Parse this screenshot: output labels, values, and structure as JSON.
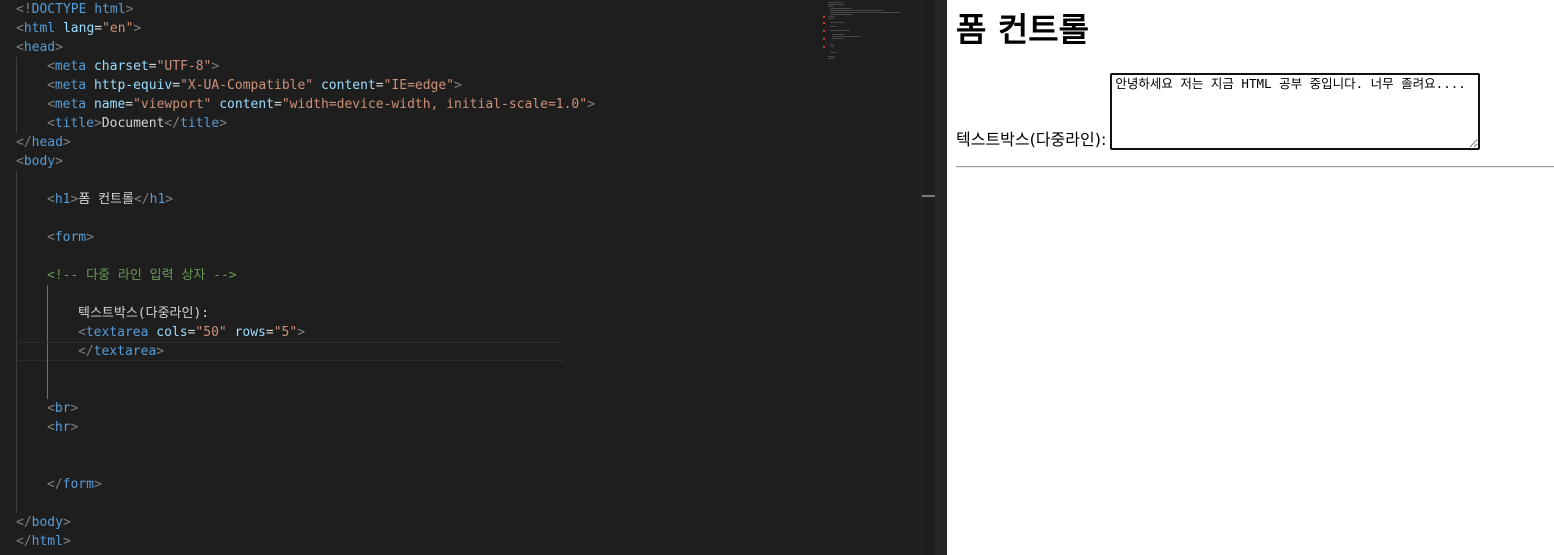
{
  "editor": {
    "lines": [
      {
        "indent": 0,
        "tokens": [
          [
            "punct",
            "<!"
          ],
          [
            "doctype",
            "DOCTYPE"
          ],
          [
            "text",
            " "
          ],
          [
            "tag",
            "html"
          ],
          [
            "punct",
            ">"
          ]
        ]
      },
      {
        "indent": 0,
        "tokens": [
          [
            "punct",
            "<"
          ],
          [
            "tag",
            "html"
          ],
          [
            "text",
            " "
          ],
          [
            "attr",
            "lang"
          ],
          [
            "text",
            "="
          ],
          [
            "str",
            "\"en\""
          ],
          [
            "punct",
            ">"
          ]
        ]
      },
      {
        "indent": 0,
        "tokens": [
          [
            "punct",
            "<"
          ],
          [
            "tag",
            "head"
          ],
          [
            "punct",
            ">"
          ]
        ]
      },
      {
        "indent": 1,
        "tokens": [
          [
            "punct",
            "<"
          ],
          [
            "tag",
            "meta"
          ],
          [
            "text",
            " "
          ],
          [
            "attr",
            "charset"
          ],
          [
            "text",
            "="
          ],
          [
            "str",
            "\"UTF-8\""
          ],
          [
            "punct",
            ">"
          ]
        ]
      },
      {
        "indent": 1,
        "tokens": [
          [
            "punct",
            "<"
          ],
          [
            "tag",
            "meta"
          ],
          [
            "text",
            " "
          ],
          [
            "attr",
            "http-equiv"
          ],
          [
            "text",
            "="
          ],
          [
            "str",
            "\"X-UA-Compatible\""
          ],
          [
            "text",
            " "
          ],
          [
            "attr",
            "content"
          ],
          [
            "text",
            "="
          ],
          [
            "str",
            "\"IE=edge\""
          ],
          [
            "punct",
            ">"
          ]
        ]
      },
      {
        "indent": 1,
        "tokens": [
          [
            "punct",
            "<"
          ],
          [
            "tag",
            "meta"
          ],
          [
            "text",
            " "
          ],
          [
            "attr",
            "name"
          ],
          [
            "text",
            "="
          ],
          [
            "str",
            "\"viewport\""
          ],
          [
            "text",
            " "
          ],
          [
            "attr",
            "content"
          ],
          [
            "text",
            "="
          ],
          [
            "str",
            "\"width=device-width, initial-scale=1.0\""
          ],
          [
            "punct",
            ">"
          ]
        ]
      },
      {
        "indent": 1,
        "tokens": [
          [
            "punct",
            "<"
          ],
          [
            "tag",
            "title"
          ],
          [
            "punct",
            ">"
          ],
          [
            "text",
            "Document"
          ],
          [
            "punct",
            "</"
          ],
          [
            "tag",
            "title"
          ],
          [
            "punct",
            ">"
          ]
        ]
      },
      {
        "indent": 0,
        "tokens": [
          [
            "punct",
            "</"
          ],
          [
            "tag",
            "head"
          ],
          [
            "punct",
            ">"
          ]
        ]
      },
      {
        "indent": 0,
        "tokens": [
          [
            "punct",
            "<"
          ],
          [
            "tag",
            "body"
          ],
          [
            "punct",
            ">"
          ]
        ]
      },
      {
        "indent": 1,
        "tokens": []
      },
      {
        "indent": 1,
        "tokens": [
          [
            "punct",
            "<"
          ],
          [
            "tag",
            "h1"
          ],
          [
            "punct",
            ">"
          ],
          [
            "text",
            "폼 컨트롤"
          ],
          [
            "punct",
            "</"
          ],
          [
            "tag",
            "h1"
          ],
          [
            "punct",
            ">"
          ]
        ]
      },
      {
        "indent": 1,
        "tokens": []
      },
      {
        "indent": 1,
        "tokens": [
          [
            "punct",
            "<"
          ],
          [
            "tag",
            "form"
          ],
          [
            "punct",
            ">"
          ]
        ]
      },
      {
        "indent": 1,
        "tokens": []
      },
      {
        "indent": 1,
        "tokens": [
          [
            "punct",
            "<!-- 다중 라인 입력 상자 -->"
          ]
        ]
      },
      {
        "indent": 2,
        "tokens": []
      },
      {
        "indent": 2,
        "tokens": [
          [
            "text",
            "텍스트박스(다중라인):"
          ]
        ]
      },
      {
        "indent": 2,
        "tokens": [
          [
            "punct",
            "<"
          ],
          [
            "tag",
            "textarea"
          ],
          [
            "text",
            " "
          ],
          [
            "attr",
            "cols"
          ],
          [
            "text",
            "="
          ],
          [
            "str",
            "\"50\""
          ],
          [
            "text",
            " "
          ],
          [
            "attr",
            "rows"
          ],
          [
            "text",
            "="
          ],
          [
            "str",
            "\"5\""
          ],
          [
            "punct",
            ">"
          ]
        ]
      },
      {
        "indent": 2,
        "current": true,
        "tokens": [
          [
            "punct",
            "</"
          ],
          [
            "tag",
            "textarea"
          ],
          [
            "punct",
            ">"
          ]
        ]
      },
      {
        "indent": 2,
        "tokens": []
      },
      {
        "indent": 2,
        "tokens": []
      },
      {
        "indent": 1,
        "tokens": [
          [
            "punct",
            "<"
          ],
          [
            "tag",
            "br"
          ],
          [
            "punct",
            ">"
          ]
        ]
      },
      {
        "indent": 1,
        "tokens": [
          [
            "punct",
            "<"
          ],
          [
            "tag",
            "hr"
          ],
          [
            "punct",
            ">"
          ]
        ]
      },
      {
        "indent": 1,
        "tokens": []
      },
      {
        "indent": 1,
        "tokens": []
      },
      {
        "indent": 1,
        "tokens": [
          [
            "punct",
            "</"
          ],
          [
            "tag",
            "form"
          ],
          [
            "punct",
            ">"
          ]
        ]
      },
      {
        "indent": 1,
        "tokens": []
      },
      {
        "indent": 0,
        "tokens": [
          [
            "punct",
            "</"
          ],
          [
            "tag",
            "body"
          ],
          [
            "punct",
            ">"
          ]
        ]
      },
      {
        "indent": 0,
        "tokens": [
          [
            "punct",
            "</"
          ],
          [
            "tag",
            "html"
          ],
          [
            "punct",
            ">"
          ]
        ]
      }
    ]
  },
  "preview": {
    "heading": "폼 컨트롤",
    "label": "텍스트박스(다중라인):",
    "textarea_value": "안녕하세요 저는 지금 HTML 공부 중입니다. 너무 졸려요...."
  }
}
